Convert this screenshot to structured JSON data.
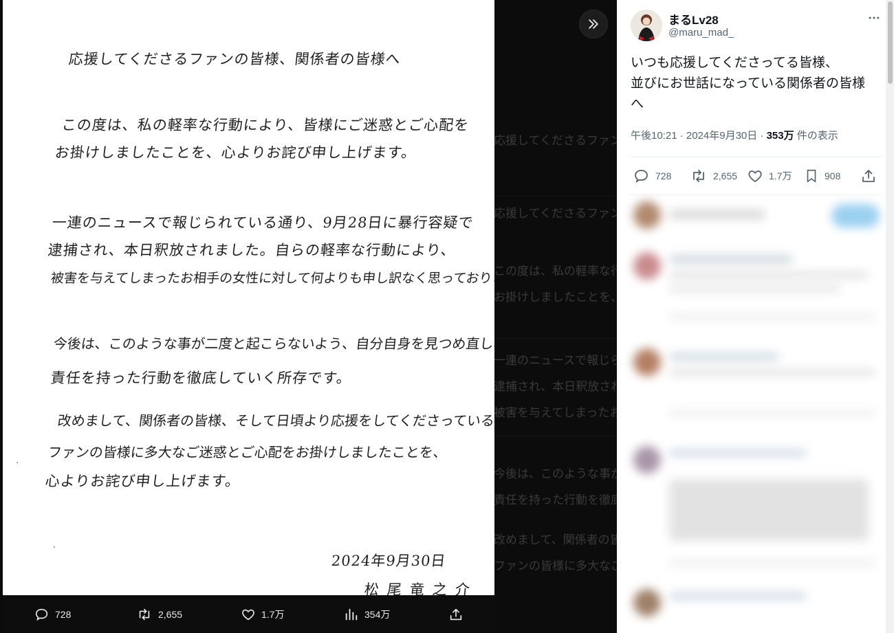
{
  "letter": {
    "greeting": "応援してくださるファンの皆様、関係者の皆様へ",
    "p1": [
      "この度は、私の軽率な行動により、皆様にご迷惑とご心配を",
      "お掛けしましたことを、心よりお詫び申し上げます。"
    ],
    "p2": [
      "一連のニュースで報じられている通り、9月28日に暴行容疑で",
      "逮捕され、本日釈放されました。自らの軽率な行動により、",
      "被害を与えてしまったお相手の女性に対して何よりも申し訳なく思っております。"
    ],
    "p3": [
      "今後は、このような事が二度と起こらないよう、自分自身を見つめ直し、",
      "責任を持った行動を徹底していく所存です。"
    ],
    "p4": [
      "改めまして、関係者の皆様、そして日頃より応援をしてくださっている",
      "ファンの皆様に多大なご迷惑とご心配をお掛けしましたことを、",
      "心よりお詫び申し上げます。"
    ],
    "date": "2024年9月30日",
    "signature": "松尾竜之介"
  },
  "media_bar": {
    "replies": "728",
    "reposts": "2,655",
    "likes": "1.7万",
    "views": "354万"
  },
  "tweet": {
    "display_name": "まるLv28",
    "handle": "@maru_mad_",
    "text_lines": [
      "いつも応援してくださってる皆様、",
      "並びにお世話になっている関係者の皆様",
      "へ"
    ],
    "time": "午後10:21 · 2024年9月30日 · ",
    "views": "353万",
    "views_suffix": " 件の表示",
    "replies": "728",
    "reposts": "2,655",
    "likes": "1.7万",
    "bookmarks": "908"
  },
  "icons": {
    "collapse": "double-chevron-right-icon",
    "reply": "reply-icon",
    "repost": "repost-icon",
    "like": "heart-icon",
    "views": "views-bar-chart-icon",
    "bookmark": "bookmark-icon",
    "share": "share-icon",
    "more": "more-dots-icon"
  },
  "colors": {
    "panel_bg": "#ffffff",
    "viewer_bg": "#0c0c0c",
    "text_primary": "#0f1419",
    "text_secondary": "#536471"
  }
}
